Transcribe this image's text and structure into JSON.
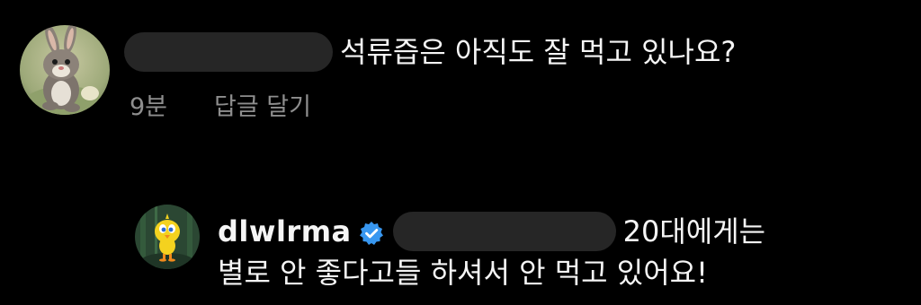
{
  "comments": {
    "top": {
      "text": "석류즙은 아직도 잘 먹고 있나요?",
      "time": "9분",
      "reply_label": "답글 달기"
    },
    "reply": {
      "username": "dlwlrma",
      "text_line1": "20대에게는",
      "text_line2": "별로 안 좋다고들 하셔서 안 먹고 있어요!"
    }
  },
  "icons": {
    "top_avatar": "rabbit-avatar-icon",
    "reply_avatar": "yellow-bird-avatar-icon",
    "verified": "verified-badge-icon"
  },
  "colors": {
    "background": "#000000",
    "text": "#f5f5f5",
    "meta_text": "#8e8e8e",
    "redaction": "#262626",
    "verified_badge": "#3897f0"
  }
}
